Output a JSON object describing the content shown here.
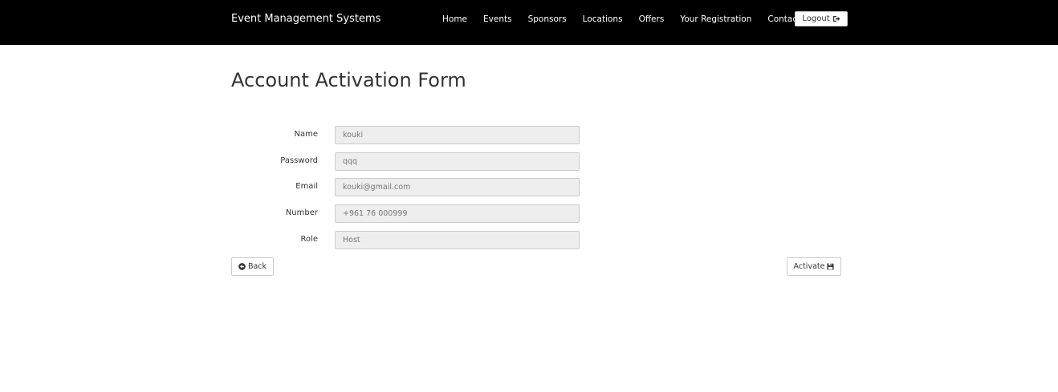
{
  "navbar": {
    "brand": "Event Management Systems",
    "links": [
      "Home",
      "Events",
      "Sponsors",
      "Locations",
      "Offers",
      "Your Registration",
      "Contact Us"
    ],
    "logout_label": "Logout",
    "logout_icon": "sign-out-icon"
  },
  "page": {
    "title": "Account Activation Form"
  },
  "form": {
    "fields": [
      {
        "label": "Name",
        "value": "kouki"
      },
      {
        "label": "Password",
        "value": "qqq"
      },
      {
        "label": "Email",
        "value": "kouki@gmail.com"
      },
      {
        "label": "Number",
        "value": "+961 76 000999"
      },
      {
        "label": "Role",
        "value": "Host"
      }
    ],
    "back_label": "Back",
    "back_icon": "circle-arrow-left-icon",
    "activate_label": "Activate",
    "activate_icon": "floppy-disk-icon"
  },
  "colors": {
    "navbar_bg": "#000000",
    "input_bg": "#eeeeee"
  }
}
